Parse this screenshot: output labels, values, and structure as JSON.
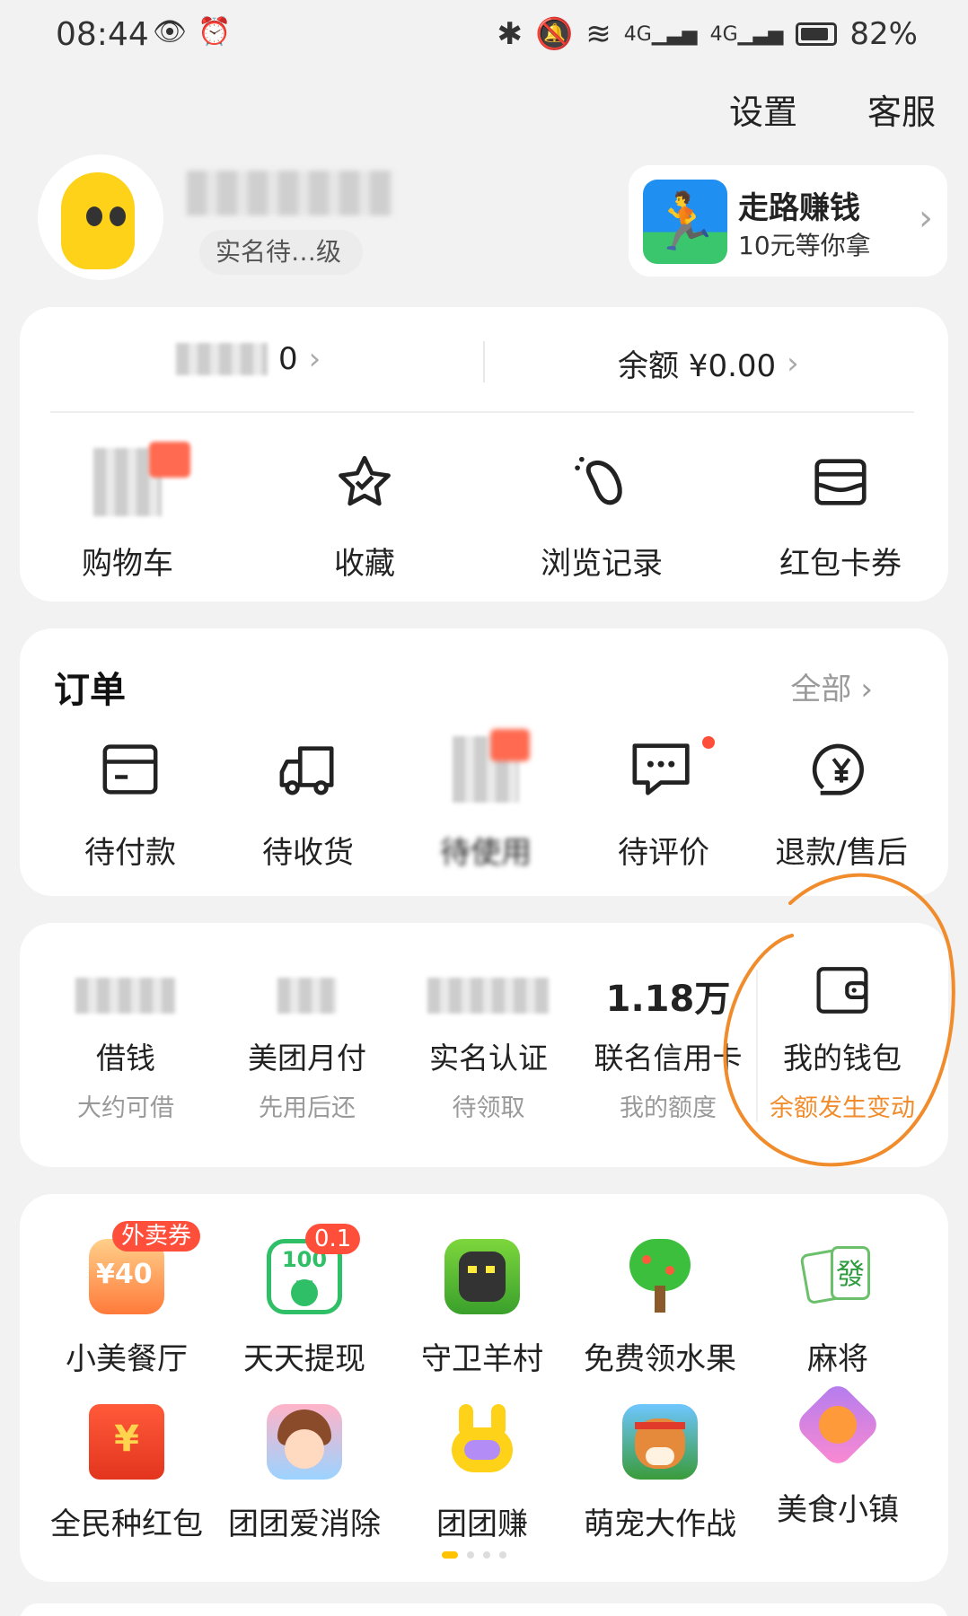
{
  "status_bar": {
    "time": "08:44",
    "battery": "82%"
  },
  "top_links": {
    "settings": "设置",
    "service": "客服"
  },
  "profile": {
    "level_text": "实名待…级"
  },
  "walk_promo": {
    "title": "走路赚钱",
    "subtitle": "10元等你拿"
  },
  "balance": {
    "left_value": "0",
    "right_label": "余额 ¥0.00"
  },
  "quick_actions": [
    {
      "label": "购物车"
    },
    {
      "label": "收藏"
    },
    {
      "label": "浏览记录"
    },
    {
      "label": "红包卡券"
    }
  ],
  "orders": {
    "title": "订单",
    "all_label": "全部",
    "items": [
      {
        "label": "待付款"
      },
      {
        "label": "待收货"
      },
      {
        "label": "待使用"
      },
      {
        "label": "待评价"
      },
      {
        "label": "退款/售后"
      }
    ]
  },
  "finance": [
    {
      "value": "",
      "label": "借钱",
      "sub": "大约可借"
    },
    {
      "value": "",
      "label": "美团月付",
      "sub": "先用后还"
    },
    {
      "value": "",
      "label": "实名认证",
      "sub": "待领取"
    },
    {
      "value": "1.18万",
      "label": "联名信用卡",
      "sub": "我的额度"
    },
    {
      "value": "",
      "label": "我的钱包",
      "sub": "余额发生变动"
    }
  ],
  "apps_row1": [
    {
      "label": "小美餐厅",
      "badge": "外卖券",
      "icon_text": "¥40"
    },
    {
      "label": "天天提现",
      "badge": "0.1",
      "icon_text": "100元"
    },
    {
      "label": "守卫羊村"
    },
    {
      "label": "免费领水果"
    },
    {
      "label": "麻将",
      "icon_text": "發"
    }
  ],
  "apps_row2": [
    {
      "label": "全民种红包",
      "icon_text": "¥"
    },
    {
      "label": "团团爱消除"
    },
    {
      "label": "团团赚"
    },
    {
      "label": "萌宠大作战"
    },
    {
      "label": "美食小镇"
    }
  ],
  "colors": {
    "accent_orange": "#f08c2c",
    "badge_red": "#ff4f3b",
    "dot_active": "#ffc300"
  }
}
